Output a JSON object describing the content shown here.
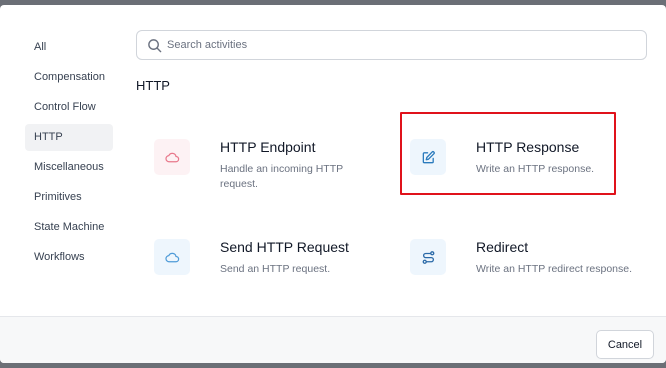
{
  "sidebar": {
    "items": [
      {
        "label": "All"
      },
      {
        "label": "Compensation"
      },
      {
        "label": "Control Flow"
      },
      {
        "label": "HTTP",
        "active": true
      },
      {
        "label": "Miscellaneous"
      },
      {
        "label": "Primitives"
      },
      {
        "label": "State Machine"
      },
      {
        "label": "Workflows"
      }
    ]
  },
  "search": {
    "placeholder": "Search activities",
    "value": ""
  },
  "section": {
    "title": "HTTP"
  },
  "activities": [
    {
      "title": "HTTP Endpoint",
      "description": "Handle an incoming HTTP request.",
      "icon": "cloud-icon",
      "icon_color": "#e8788b"
    },
    {
      "title": "HTTP Response",
      "description": "Write an HTTP response.",
      "icon": "edit-icon",
      "icon_color": "#2b7bbd",
      "highlighted": true
    },
    {
      "title": "Send HTTP Request",
      "description": "Send an HTTP request.",
      "icon": "cloud-icon",
      "icon_color": "#4f9bd8"
    },
    {
      "title": "Redirect",
      "description": "Write an HTTP redirect response.",
      "icon": "route-icon",
      "icon_color": "#2b6aa8"
    }
  ],
  "footer": {
    "cancel_label": "Cancel"
  },
  "colors": {
    "highlight": "#e0121b",
    "accent_blue": "#2b7bbd",
    "accent_pink": "#e8788b"
  }
}
